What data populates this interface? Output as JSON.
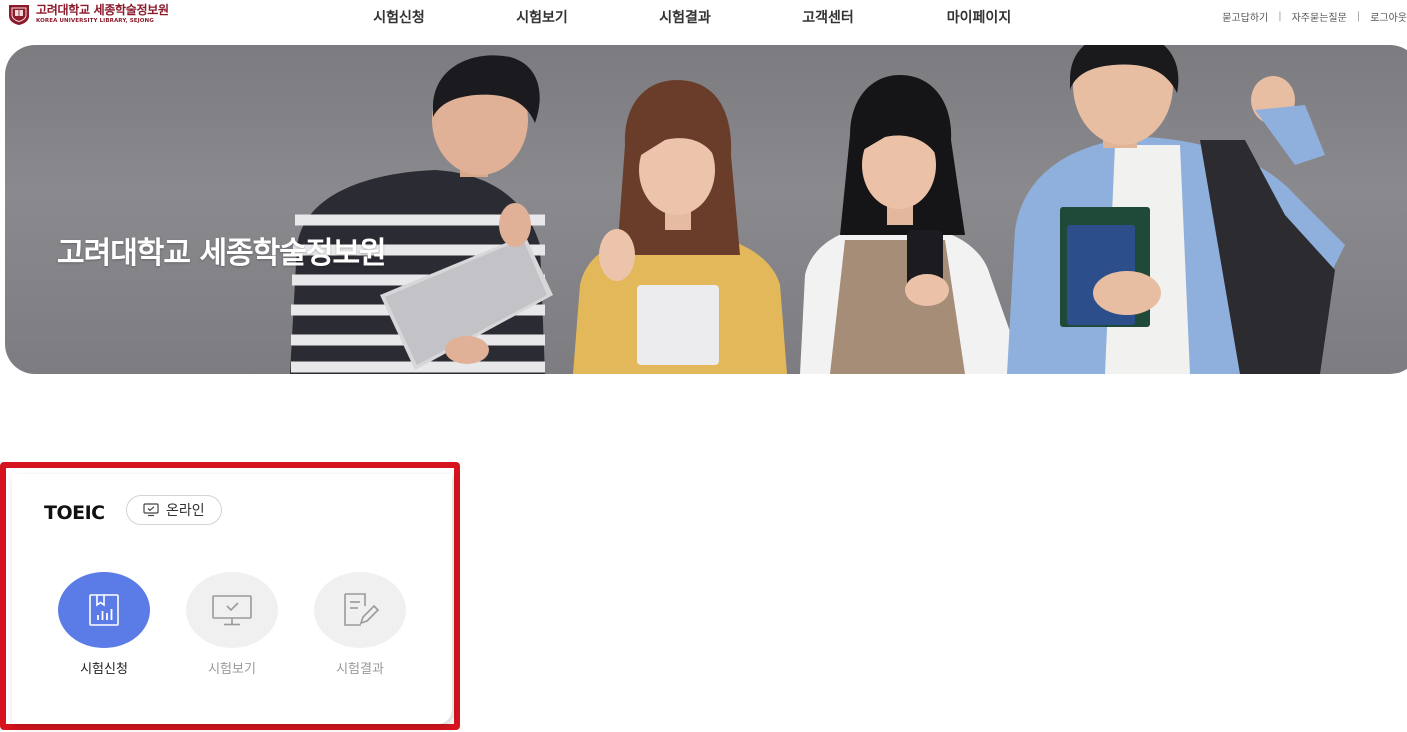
{
  "header": {
    "logo": {
      "title_ko": "고려대학교 세종학술정보원",
      "title_en": "KOREA UNIVERSITY LIBRARY, SEJONG"
    },
    "nav": [
      {
        "label": "시험신청"
      },
      {
        "label": "시험보기"
      },
      {
        "label": "시험결과"
      },
      {
        "label": "고객센터"
      },
      {
        "label": "마이페이지"
      }
    ],
    "util_links": [
      {
        "label": "묻고답하기"
      },
      {
        "label": "자주묻는질문"
      },
      {
        "label": "로그아웃"
      }
    ],
    "util_separator": "|"
  },
  "hero": {
    "title": "고려대학교 세종학술정보원"
  },
  "exam_card": {
    "title": "TOEIC",
    "badge": {
      "label": "온라인",
      "icon": "monitor-check-icon"
    },
    "highlight_color": "#d6141e",
    "steps": [
      {
        "label": "시험신청",
        "icon": "application-chart-icon",
        "state": "active"
      },
      {
        "label": "시험보기",
        "icon": "monitor-check-icon",
        "state": "inactive"
      },
      {
        "label": "시험결과",
        "icon": "document-edit-icon",
        "state": "inactive"
      }
    ]
  },
  "colors": {
    "brand": "#8b1a2b",
    "accent": "#5b7be6",
    "highlight": "#d6141e"
  }
}
